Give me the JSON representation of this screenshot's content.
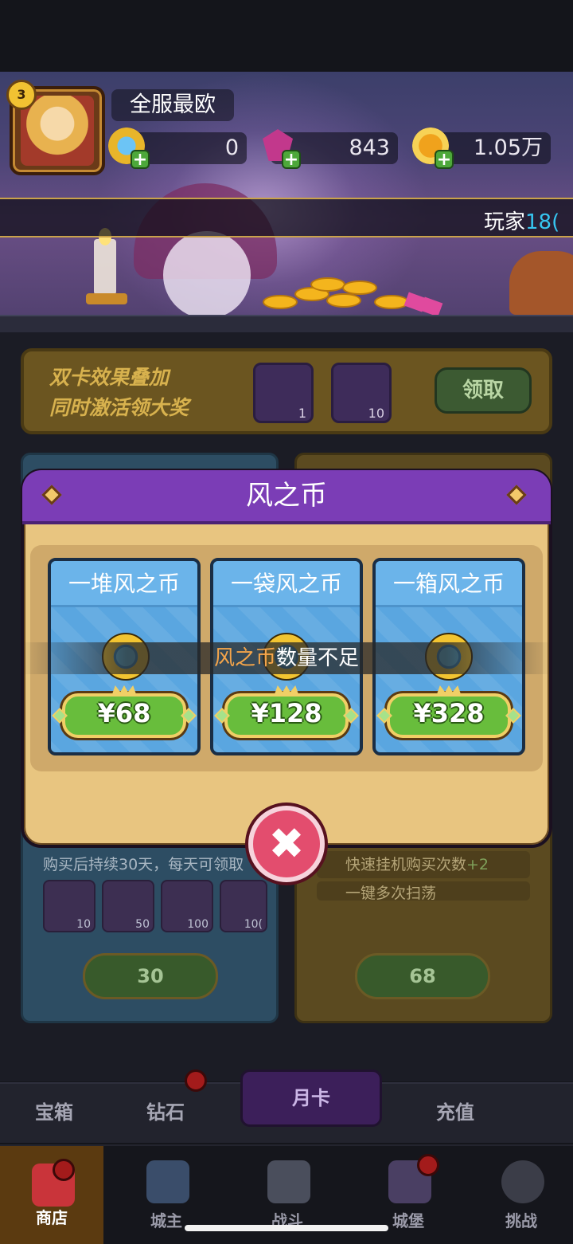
{
  "player": {
    "level": "3",
    "name": "全服最欧",
    "resources": {
      "wind_coin": "0",
      "gem": "843",
      "gold": "1.05万"
    }
  },
  "marquee": {
    "prefix": "玩家",
    "highlight": "18("
  },
  "double_card": {
    "line1": "双卡效果叠加",
    "line2": "同时激活领大奖",
    "item1_count": "1",
    "item2_count": "10",
    "claim_label": "领取"
  },
  "left_card": {
    "note": "购买后持续30天，每天可领取",
    "items": [
      "10",
      "50",
      "100",
      "10("
    ],
    "price": "30"
  },
  "right_card": {
    "perk1": "快速挂机购买次数",
    "perk1_bonus": "+2",
    "perk2": "一键多次扫荡",
    "price": "68"
  },
  "tabs": {
    "chest": "宝箱",
    "diamond": "钻石",
    "monthly": "月卡",
    "recharge": "充值"
  },
  "nav": {
    "shop": "商店",
    "lord": "城主",
    "battle": "战斗",
    "castle": "城堡",
    "challenge": "挑战"
  },
  "modal": {
    "title": "风之币",
    "products": [
      {
        "name": "一堆风之币",
        "price": "¥68"
      },
      {
        "name": "一袋风之币",
        "price": "¥128"
      },
      {
        "name": "一箱风之币",
        "price": "¥328"
      }
    ],
    "toast": {
      "highlight": "风之币",
      "rest": "数量不足"
    },
    "close_symbol": "✖"
  },
  "colors": {
    "modal_header": "#7b3db6",
    "modal_body": "#e8c580",
    "product_card": "#5aa6e0",
    "price_plate": "#68bd3c",
    "close_button": "#e34d6e",
    "toast_highlight": "#f5a54a"
  }
}
